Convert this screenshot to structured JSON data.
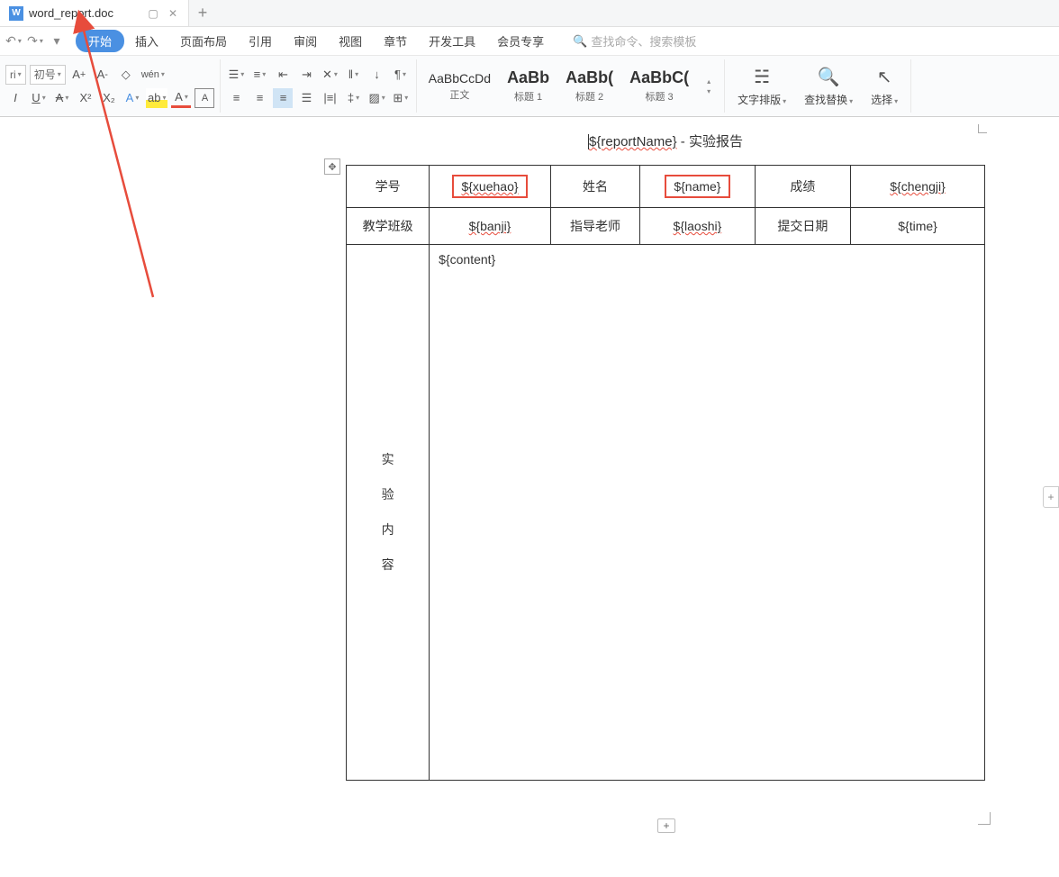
{
  "tab": {
    "title": "word_report.doc"
  },
  "qat": {
    "undo": "↶",
    "redo": "↷"
  },
  "menu": {
    "tabs": [
      "开始",
      "插入",
      "页面布局",
      "引用",
      "审阅",
      "视图",
      "章节",
      "开发工具",
      "会员专享"
    ],
    "active_index": 0,
    "search_placeholder": "查找命令、搜索模板"
  },
  "ribbon": {
    "font_name": "ri",
    "font_size": "初号",
    "styles": [
      {
        "preview": "AaBbCcDd",
        "name": "正文",
        "big": false
      },
      {
        "preview": "AaBb",
        "name": "标题 1",
        "big": true
      },
      {
        "preview": "AaBb(",
        "name": "标题 2",
        "big": true
      },
      {
        "preview": "AaBbC(",
        "name": "标题 3",
        "big": true
      }
    ],
    "text_layout": "文字排版",
    "find_replace": "查找替换",
    "select": "选择"
  },
  "doc": {
    "title_prefix": "${reportName}",
    "title_suffix": " - 实验报告",
    "row1": {
      "c1": "学号",
      "c2": "${xuehao}",
      "c3": "姓名",
      "c4": "${name}",
      "c5": "成绩",
      "c6": "${chengji}"
    },
    "row2": {
      "c1": "教学班级",
      "c2": "${banji}",
      "c3": "指导老师",
      "c4": "${laoshi}",
      "c5": "提交日期",
      "c6": "${time}"
    },
    "row3": {
      "label_chars": [
        "实",
        "验",
        "内",
        "容"
      ],
      "content": "${content}"
    }
  }
}
